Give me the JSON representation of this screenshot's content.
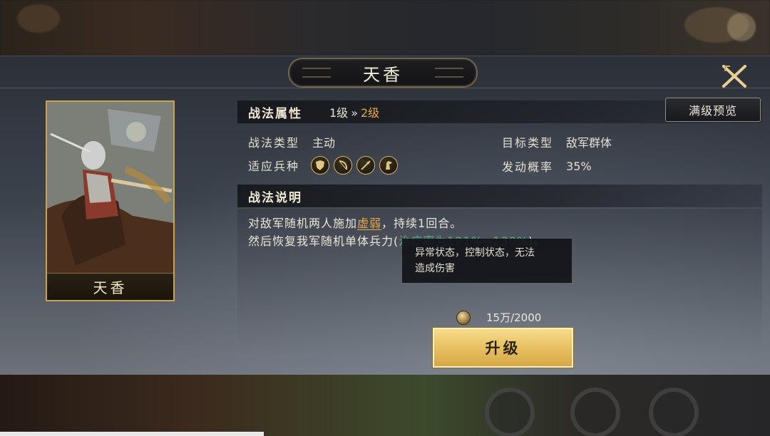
{
  "header": {
    "title": "天香"
  },
  "hero": {
    "name": "天香"
  },
  "tactic": {
    "section_title": "战法属性",
    "level_current": "1级",
    "level_arrow": "»",
    "level_next": "2级",
    "max_preview_label": "满级预览",
    "type_label": "战法类型",
    "type_value": "主动",
    "target_label": "目标类型",
    "target_value": "敌军群体",
    "troop_label": "适应兵种",
    "troop_icons": [
      "shield-icon",
      "bow-icon",
      "spear-icon",
      "horse-icon"
    ],
    "chance_label": "发动概率",
    "chance_value": "35%"
  },
  "description": {
    "section_title": "战法说明",
    "line1_prefix": "对敌军随机两人施加",
    "line1_keyword": "虚弱",
    "line1_suffix": "，持续1回合。",
    "line2_prefix": "然后恢复我军随机单体兵力(",
    "line2_heal": "治疗率为121%→130%",
    "line2_suffix": ")。"
  },
  "tooltip": {
    "line1": "异常状态，控制状态，无法",
    "line2": "造成伤害"
  },
  "cost": {
    "text": "15万/2000"
  },
  "upgrade": {
    "label": "升级"
  },
  "colors": {
    "accent_orange": "#e8a94a",
    "heal_green": "#55b07e",
    "button_gold": "#e9c265",
    "card_border": "#c9a254"
  }
}
